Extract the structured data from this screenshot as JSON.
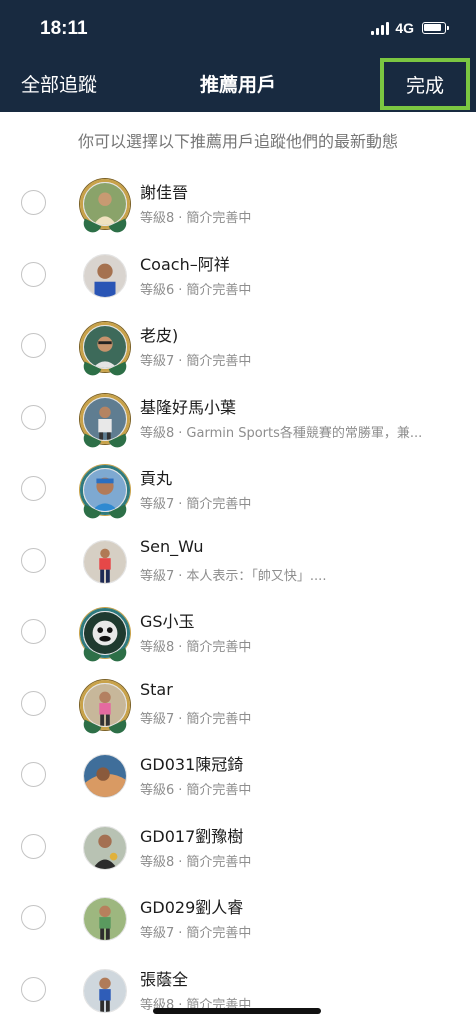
{
  "status_bar": {
    "time": "18:11",
    "network": "4G"
  },
  "nav": {
    "left_label": "全部追蹤",
    "title": "推薦用戶",
    "done_label": "完成"
  },
  "subtitle": "你可以選擇以下推薦用戶追蹤他們的最新動態",
  "users": [
    {
      "name": "謝佳晉",
      "level": "等級8",
      "bio": "簡介完善中"
    },
    {
      "name": "Coach–阿祥",
      "level": "等級6",
      "bio": "簡介完善中"
    },
    {
      "name": "老皮)",
      "level": "等級7",
      "bio": "簡介完善中"
    },
    {
      "name": "基隆好馬小葉",
      "level": "等級8",
      "bio": "Garmin Sports各種競賽的常勝軍，兼..."
    },
    {
      "name": "貢丸",
      "level": "等級7",
      "bio": "簡介完善中"
    },
    {
      "name": "Sen_Wu",
      "level": "等級7",
      "bio": "本人表示：「帥又快」...."
    },
    {
      "name": "GS小玉",
      "level": "等級8",
      "bio": "簡介完善中"
    },
    {
      "name": "Star",
      "level": "等級7",
      "bio": "簡介完善中"
    },
    {
      "name": "GD031陳冠錡",
      "level": "等級6",
      "bio": "簡介完善中"
    },
    {
      "name": "GD017劉豫樹",
      "level": "等級8",
      "bio": "簡介完善中"
    },
    {
      "name": "GD029劉人睿",
      "level": "等級7",
      "bio": "簡介完善中"
    },
    {
      "name": "張蔭全",
      "level": "等級8",
      "bio": "簡介完善中"
    }
  ],
  "meta_separator": "·",
  "colors": {
    "header_bg": "#182a40",
    "highlight": "#7bc641",
    "muted": "#8e8e8e"
  }
}
